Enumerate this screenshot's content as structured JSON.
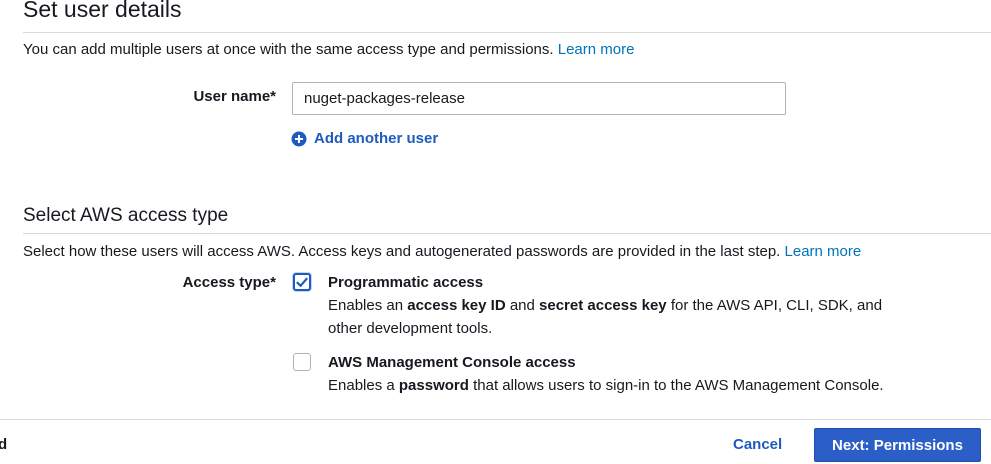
{
  "user_details": {
    "title": "Set user details",
    "description": "You can add multiple users at once with the same access type and permissions.",
    "learn_more": "Learn more",
    "user_name_label": "User name*",
    "user_name_value": "nuget-packages-release",
    "add_another_user": "Add another user"
  },
  "access_type": {
    "title": "Select AWS access type",
    "description": "Select how these users will access AWS. Access keys and autogenerated passwords are provided in the last step.",
    "learn_more": "Learn more",
    "label": "Access type*",
    "options": [
      {
        "title": "Programmatic access",
        "checked": true,
        "desc_parts": [
          "Enables an ",
          "access key ID",
          " and ",
          "secret access key",
          " for the AWS API, CLI, SDK, and other development tools."
        ]
      },
      {
        "title": "AWS Management Console access",
        "checked": false,
        "desc_parts": [
          "Enables a ",
          "password",
          " that allows users to sign-in to the AWS Management Console."
        ]
      }
    ]
  },
  "footer": {
    "left_fragment": "d",
    "cancel": "Cancel",
    "next": "Next: Permissions"
  },
  "colors": {
    "link": "#0073bb",
    "primary_button": "#2b5fc7",
    "accent_blue": "#1f5bbf"
  },
  "icons": {
    "add_user": "plus-circle-icon",
    "checked": "checkmark-icon"
  }
}
